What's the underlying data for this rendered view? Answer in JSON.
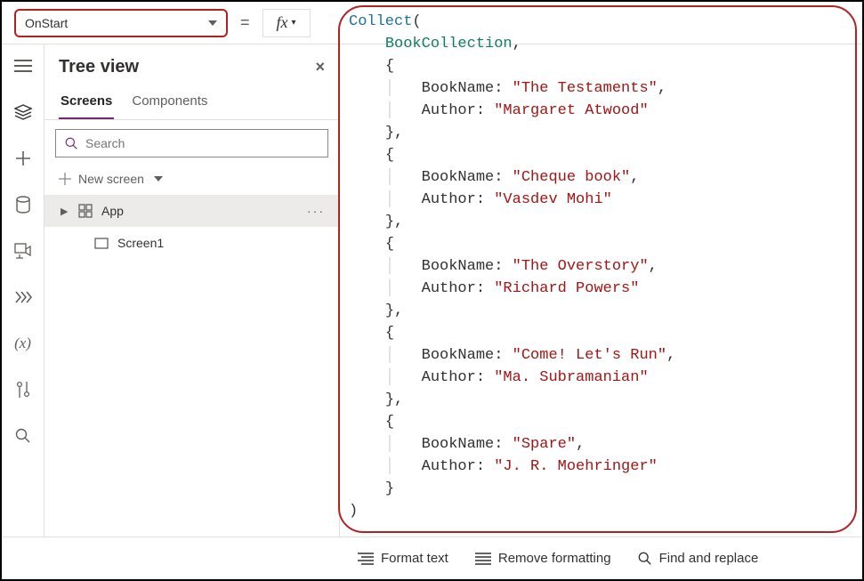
{
  "property_selector": {
    "value": "OnStart"
  },
  "tree": {
    "title": "Tree view",
    "tabs": {
      "screens": "Screens",
      "components": "Components"
    },
    "search_placeholder": "Search",
    "new_screen": "New screen",
    "items": {
      "app": "App",
      "screen1": "Screen1"
    }
  },
  "bottom": {
    "format": "Format text",
    "remove": "Remove formatting",
    "find": "Find and replace"
  },
  "formula": {
    "fn": "Collect",
    "collection": "BookCollection",
    "books": [
      {
        "BookName": "The Testaments",
        "Author": "Margaret Atwood"
      },
      {
        "BookName": "Cheque book",
        "Author": "Vasdev Mohi"
      },
      {
        "BookName": "The Overstory",
        "Author": "Richard Powers"
      },
      {
        "BookName": "Come! Let's Run",
        "Author": "Ma. Subramanian"
      },
      {
        "BookName": "Spare",
        "Author": "J. R. Moehringer"
      }
    ]
  }
}
